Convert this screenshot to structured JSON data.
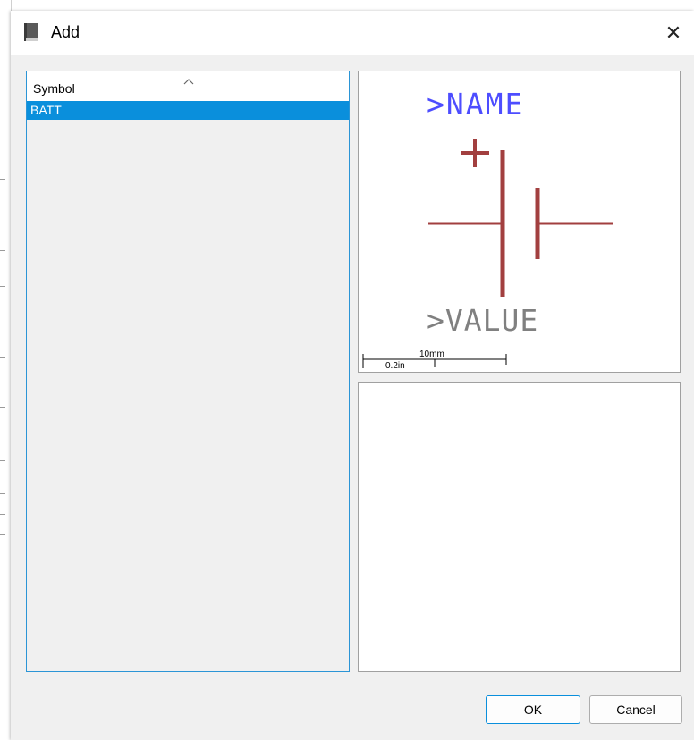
{
  "window": {
    "title": "Add",
    "title_icon": "book-icon",
    "close_icon": "close-icon",
    "close_glyph": "✕"
  },
  "symbol_list": {
    "header": "Symbol",
    "sort_icon": "sort-ascending-icon",
    "items": [
      "BATT"
    ],
    "selected_index": 0
  },
  "preview": {
    "name_text": ">NAME",
    "value_text": ">VALUE",
    "plus_text": "+",
    "scale_mm": "10mm",
    "scale_in": "0.2in",
    "colors": {
      "name": "#4d4dff",
      "symbol": "#a23f3f",
      "value": "#808080",
      "scale": "#000000"
    }
  },
  "description": {},
  "buttons": {
    "ok": "OK",
    "cancel": "Cancel"
  },
  "colors": {
    "accent": "#0a8fdc",
    "selection": "#0a8fdc"
  }
}
